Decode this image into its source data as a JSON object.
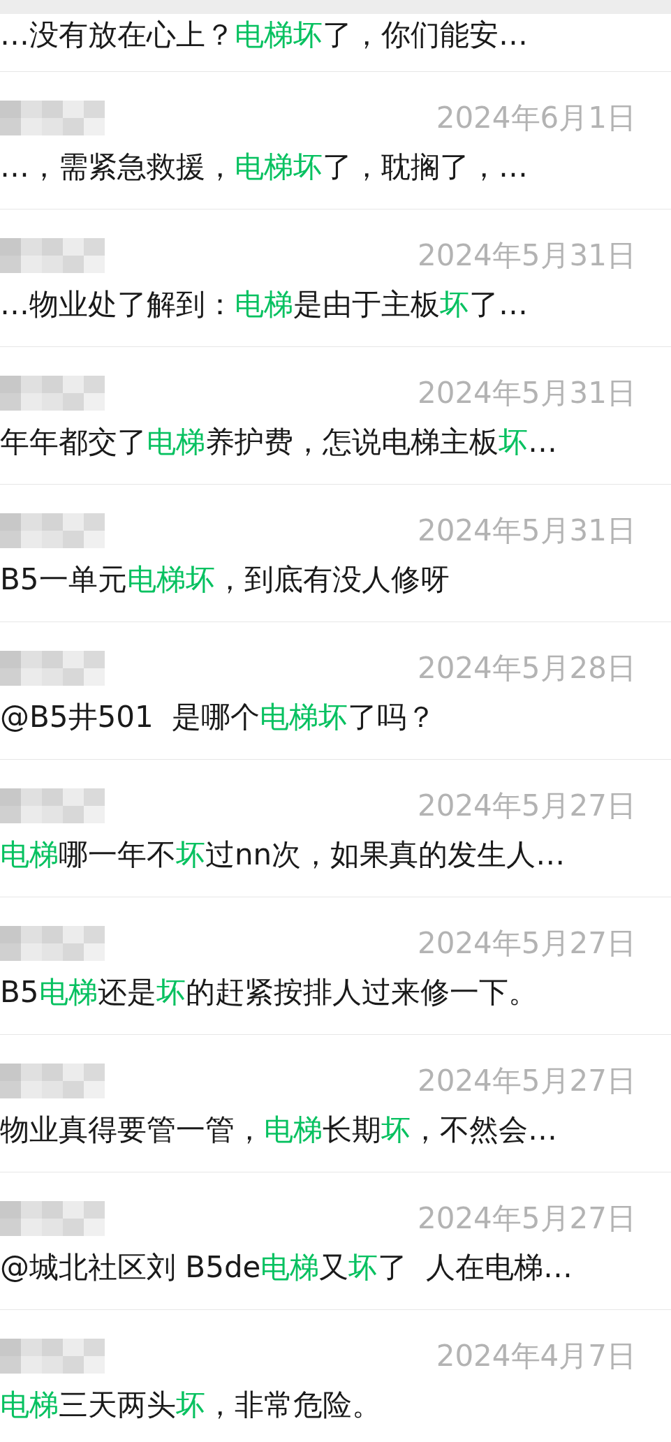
{
  "results": [
    {
      "partial": true,
      "snippet": [
        {
          "text": "…没有放在心上？",
          "highlight": false
        },
        {
          "text": "电梯坏",
          "highlight": true
        },
        {
          "text": "了，你们能安…",
          "highlight": false
        }
      ]
    },
    {
      "partial": false,
      "date": "2024年6月1日",
      "snippet": [
        {
          "text": "…，需紧急救援，",
          "highlight": false
        },
        {
          "text": "电梯坏",
          "highlight": true
        },
        {
          "text": "了，耽搁了，…",
          "highlight": false
        }
      ]
    },
    {
      "partial": false,
      "date": "2024年5月31日",
      "snippet": [
        {
          "text": "…物业处了解到：",
          "highlight": false
        },
        {
          "text": "电梯",
          "highlight": true
        },
        {
          "text": "是由于主板",
          "highlight": false
        },
        {
          "text": "坏",
          "highlight": true
        },
        {
          "text": "了…",
          "highlight": false
        }
      ]
    },
    {
      "partial": false,
      "date": "2024年5月31日",
      "snippet": [
        {
          "text": "年年都交了",
          "highlight": false
        },
        {
          "text": "电梯",
          "highlight": true
        },
        {
          "text": "养护费，怎说电梯主板",
          "highlight": false
        },
        {
          "text": "坏",
          "highlight": true
        },
        {
          "text": "…",
          "highlight": false
        }
      ]
    },
    {
      "partial": false,
      "date": "2024年5月31日",
      "snippet": [
        {
          "text": "B5一单元",
          "highlight": false
        },
        {
          "text": "电梯坏",
          "highlight": true
        },
        {
          "text": "，到底有没人修呀",
          "highlight": false
        }
      ]
    },
    {
      "partial": false,
      "date": "2024年5月28日",
      "snippet": [
        {
          "text": "@B5井501  是哪个",
          "highlight": false
        },
        {
          "text": "电梯坏",
          "highlight": true
        },
        {
          "text": "了吗？",
          "highlight": false
        }
      ]
    },
    {
      "partial": false,
      "date": "2024年5月27日",
      "snippet": [
        {
          "text": "电梯",
          "highlight": true
        },
        {
          "text": "哪一年不",
          "highlight": false
        },
        {
          "text": "坏",
          "highlight": true
        },
        {
          "text": "过nn次，如果真的发生人…",
          "highlight": false
        }
      ]
    },
    {
      "partial": false,
      "date": "2024年5月27日",
      "snippet": [
        {
          "text": "B5",
          "highlight": false
        },
        {
          "text": "电梯",
          "highlight": true
        },
        {
          "text": "还是",
          "highlight": false
        },
        {
          "text": "坏",
          "highlight": true
        },
        {
          "text": "的赶紧按排人过来修一下。",
          "highlight": false
        }
      ]
    },
    {
      "partial": false,
      "date": "2024年5月27日",
      "snippet": [
        {
          "text": "物业真得要管一管，",
          "highlight": false
        },
        {
          "text": "电梯",
          "highlight": true
        },
        {
          "text": "长期",
          "highlight": false
        },
        {
          "text": "坏",
          "highlight": true
        },
        {
          "text": "，不然会…",
          "highlight": false
        }
      ]
    },
    {
      "partial": false,
      "date": "2024年5月27日",
      "snippet": [
        {
          "text": "@城北社区刘 B5de",
          "highlight": false
        },
        {
          "text": "电梯",
          "highlight": true
        },
        {
          "text": "又",
          "highlight": false
        },
        {
          "text": "坏",
          "highlight": true
        },
        {
          "text": "了  人在电梯…",
          "highlight": false
        }
      ]
    },
    {
      "partial": false,
      "date": "2024年4月7日",
      "snippet": [
        {
          "text": "电梯",
          "highlight": true
        },
        {
          "text": "三天两头",
          "highlight": false
        },
        {
          "text": "坏",
          "highlight": true
        },
        {
          "text": "，非常危险。",
          "highlight": false
        }
      ]
    }
  ]
}
